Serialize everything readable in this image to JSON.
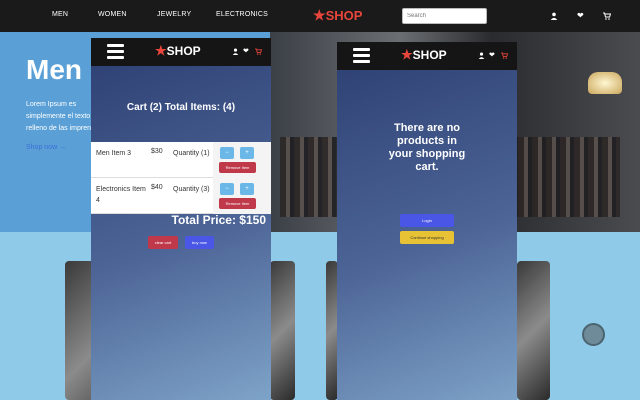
{
  "topnav": {
    "links": [
      "MEN",
      "WOMEN",
      "JEWELRY",
      "ELECTRONICS"
    ],
    "brand": "SHOP",
    "search_placeholder": "Search"
  },
  "hero": {
    "title": "Men",
    "description": "Lorem Ipsum es simplemente el texto de relleno de las imprentas y archivos de texto. Lorem Ipsum ha sido el texto de relleno estándar",
    "shop_now": "Shop now →"
  },
  "cart_panel": {
    "brand": "SHOP",
    "heading": "Cart (2) Total Items: (4)",
    "items": [
      {
        "name": "Men Item 3",
        "price": "$30",
        "quantity": "Quantity (1)",
        "remove": "Remove Item"
      },
      {
        "name": "Electronics Item 4",
        "price": "$40",
        "quantity": "Quantity (3)",
        "remove": "Remove Item"
      }
    ],
    "total": "Total Price: $150",
    "clear_label": "clear cart",
    "buy_label": "buy now"
  },
  "empty_panel": {
    "brand": "SHOP",
    "message": "There are no products in your shopping cart.",
    "login_label": "Login",
    "continue_label": "Continue shopping"
  },
  "colors": {
    "brand": "#e8453c",
    "remove": "#c0394b",
    "login": "#4a57e6",
    "continue": "#e7c234",
    "buy": "#4a57e6"
  },
  "icons": [
    "star-icon",
    "user-icon",
    "heart-icon",
    "cart-icon",
    "menu-icon",
    "plus-icon",
    "minus-icon"
  ]
}
